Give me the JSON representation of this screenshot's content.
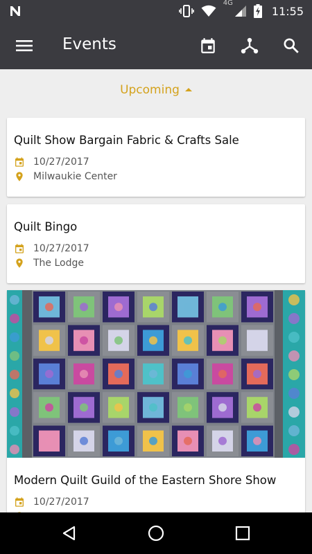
{
  "status_bar": {
    "time": "11:55",
    "network": "4G"
  },
  "app_bar": {
    "title": "Events",
    "color": "#3b3b40"
  },
  "filter": {
    "label": "Upcoming",
    "accent": "#d4a21c"
  },
  "events": [
    {
      "title": "Quilt Show Bargain Fabric & Crafts Sale",
      "date": "10/27/2017",
      "location": "Milwaukie Center"
    },
    {
      "title": "Quilt Bingo",
      "date": "10/27/2017",
      "location": "The Lodge"
    },
    {
      "title": "Modern Quilt Guild of the Eastern Shore Show",
      "date": "10/27/2017",
      "location": "",
      "image": "quilt-photo"
    }
  ],
  "icons": {
    "menu": "menu-icon",
    "calendar": "calendar-icon",
    "org": "org-chart-icon",
    "search": "search-icon",
    "date": "event-date-icon",
    "location": "location-pin-icon"
  },
  "nav": [
    "back",
    "home",
    "recents"
  ]
}
